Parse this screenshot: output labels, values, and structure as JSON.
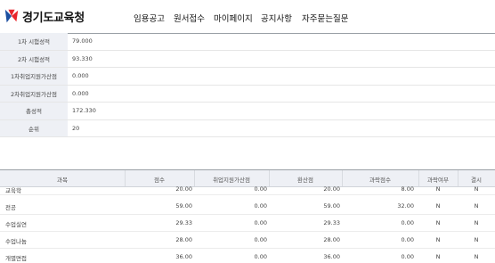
{
  "header": {
    "logo_text": "경기도교육청",
    "nav": [
      "임용공고",
      "원서접수",
      "마이페이지",
      "공지사항",
      "자주묻는질문"
    ]
  },
  "summary": [
    {
      "label": "1차 시험성적",
      "value": "79.000"
    },
    {
      "label": "2차 시험성적",
      "value": "93.330"
    },
    {
      "label": "1차취업지원가산점",
      "value": "0.000"
    },
    {
      "label": "2차취업지원가산점",
      "value": "0.000"
    },
    {
      "label": "총성적",
      "value": "172.330"
    },
    {
      "label": "순위",
      "value": "20"
    }
  ],
  "detail": {
    "headers": [
      "과목",
      "점수",
      "취업지원가산점",
      "환산점",
      "과락점수",
      "과락여부",
      "결시"
    ],
    "rows": [
      [
        "교육학",
        "20.00",
        "0.00",
        "20.00",
        "8.00",
        "N",
        "N"
      ],
      [
        "전공",
        "59.00",
        "0.00",
        "59.00",
        "32.00",
        "N",
        "N"
      ],
      [
        "수업실연",
        "29.33",
        "0.00",
        "29.33",
        "0.00",
        "N",
        "N"
      ],
      [
        "수업나눔",
        "28.00",
        "0.00",
        "28.00",
        "0.00",
        "N",
        "N"
      ],
      [
        "개별면접",
        "36.00",
        "0.00",
        "36.00",
        "0.00",
        "N",
        "N"
      ]
    ]
  },
  "colors": {
    "logo_red": "#e8262c",
    "logo_blue": "#1d4fa0",
    "header_bg": "#eef0f5"
  }
}
